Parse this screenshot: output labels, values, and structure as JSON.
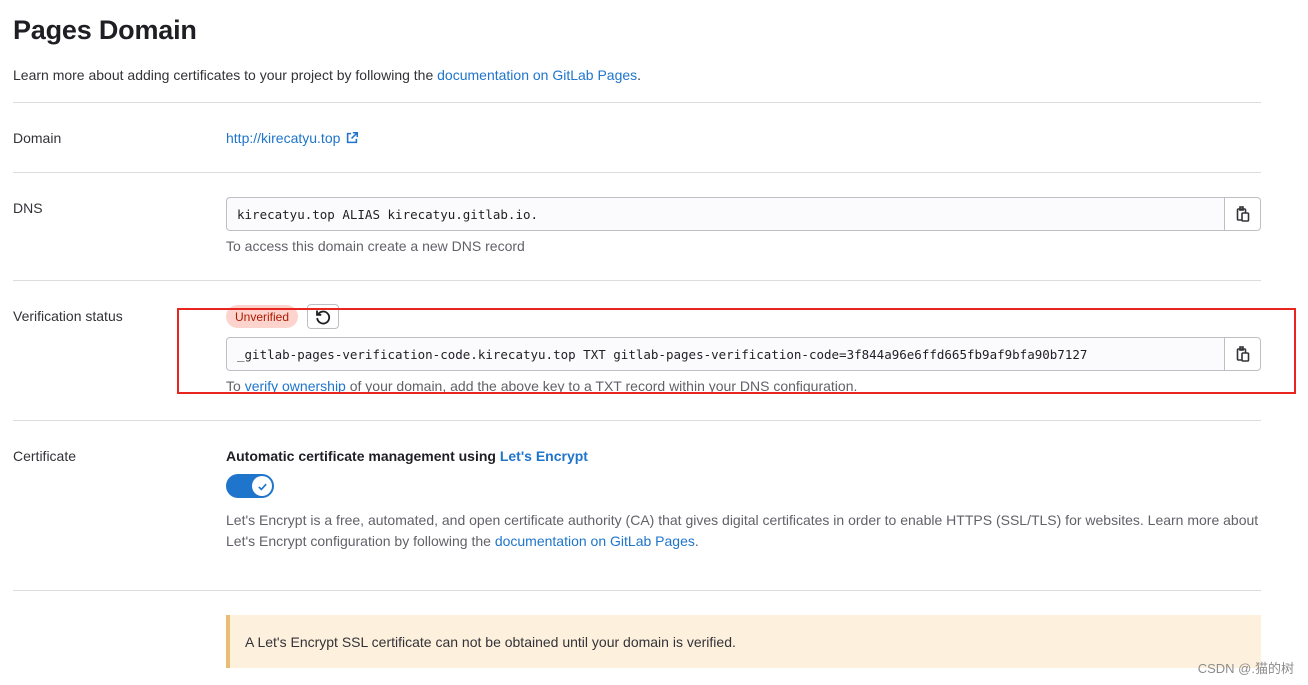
{
  "page": {
    "title": "Pages Domain",
    "intro_prefix": "Learn more about adding certificates to your project by following the ",
    "intro_link": "documentation on GitLab Pages",
    "intro_suffix": "."
  },
  "domain": {
    "label": "Domain",
    "url": "http://kirecatyu.top",
    "icon": "external-link-icon"
  },
  "dns": {
    "label": "DNS",
    "record": "kirecatyu.top ALIAS kirecatyu.gitlab.io.",
    "help": "To access this domain create a new DNS record",
    "copy_icon": "clipboard-icon"
  },
  "verification": {
    "label": "Verification status",
    "badge": "Unverified",
    "retry_icon": "retry-icon",
    "record": "_gitlab-pages-verification-code.kirecatyu.top TXT gitlab-pages-verification-code=3f844a96e6ffd665fb9af9bfa90b7127",
    "help_prefix": "To ",
    "help_link": "verify ownership",
    "help_suffix": " of your domain, add the above key to a TXT record within your DNS configuration.",
    "copy_icon": "clipboard-icon"
  },
  "certificate": {
    "label": "Certificate",
    "heading_prefix": "Automatic certificate management using ",
    "heading_link": "Let's Encrypt",
    "toggle_on": true,
    "desc_prefix": "Let's Encrypt is a free, automated, and open certificate authority (CA) that gives digital certificates in order to enable HTTPS (SSL/TLS) for websites. Learn more about Let's Encrypt configuration by following the ",
    "desc_link": "documentation on GitLab Pages",
    "desc_suffix": "."
  },
  "alert": {
    "text": "A Let's Encrypt SSL certificate can not be obtained until your domain is verified."
  },
  "watermark": "CSDN @.猫的树",
  "colors": {
    "link": "#1f75cb",
    "badge_bg": "#fdd4cd",
    "badge_text": "#ae1800",
    "highlight": "#e8261f",
    "alert_bg": "#fdf1dd"
  }
}
